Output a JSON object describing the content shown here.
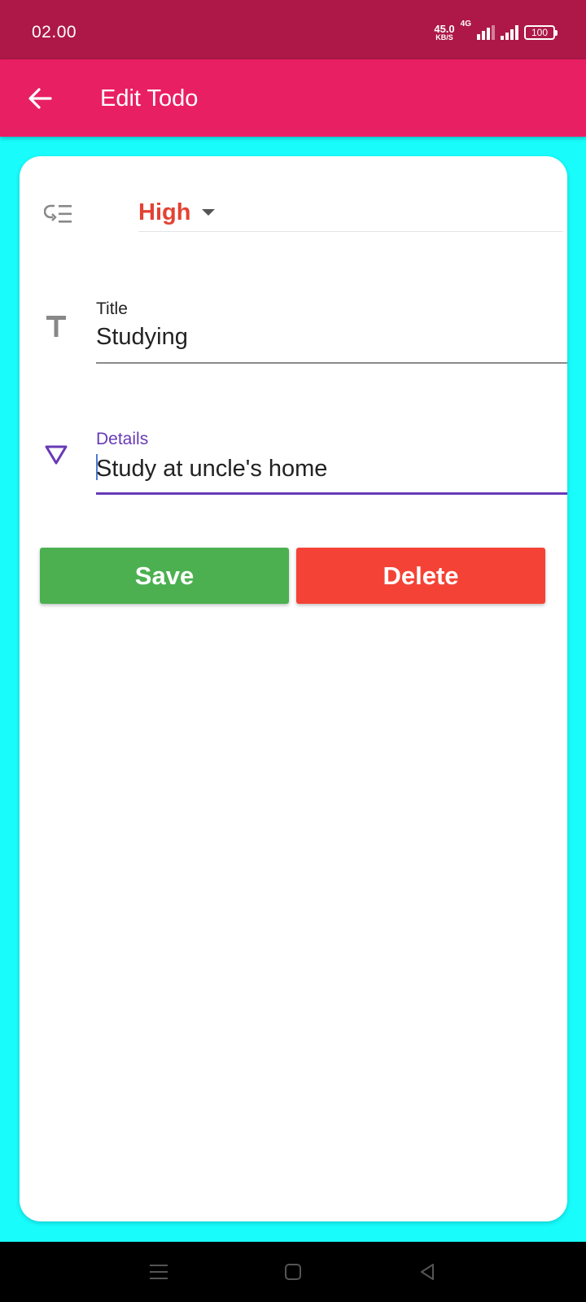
{
  "status_bar": {
    "time": "02.00",
    "net_speed_value": "45.0",
    "net_speed_unit": "KB/S",
    "network_type": "4G",
    "battery": "100"
  },
  "app_bar": {
    "title": "Edit Todo",
    "back_icon": "arrow-left-icon"
  },
  "form": {
    "priority": {
      "icon": "low-priority-icon",
      "value": "High",
      "value_color": "#e34233"
    },
    "title_field": {
      "icon": "text-title-icon",
      "label": "Title",
      "value": "Studying"
    },
    "details_field": {
      "icon": "triangle-down-outline-icon",
      "label": "Details",
      "value": "Study at uncle's home",
      "focused": true
    }
  },
  "actions": {
    "save_label": "Save",
    "delete_label": "Delete",
    "save_color": "#4cb050",
    "delete_color": "#f44336"
  },
  "colors": {
    "status_bar": "#ad1848",
    "app_bar": "#e91f63",
    "background": "#18fcfc",
    "accent": "#673ab7"
  },
  "nav_bar": {
    "items": [
      "menu-icon",
      "home-square-icon",
      "back-triangle-icon"
    ]
  }
}
